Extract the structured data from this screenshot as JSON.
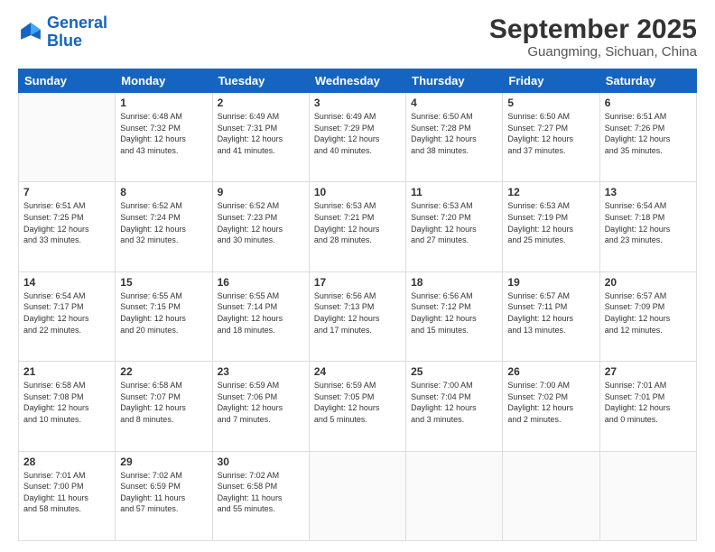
{
  "logo": {
    "line1": "General",
    "line2": "Blue"
  },
  "header": {
    "month": "September 2025",
    "location": "Guangming, Sichuan, China"
  },
  "weekdays": [
    "Sunday",
    "Monday",
    "Tuesday",
    "Wednesday",
    "Thursday",
    "Friday",
    "Saturday"
  ],
  "weeks": [
    [
      {
        "day": "",
        "info": ""
      },
      {
        "day": "1",
        "info": "Sunrise: 6:48 AM\nSunset: 7:32 PM\nDaylight: 12 hours\nand 43 minutes."
      },
      {
        "day": "2",
        "info": "Sunrise: 6:49 AM\nSunset: 7:31 PM\nDaylight: 12 hours\nand 41 minutes."
      },
      {
        "day": "3",
        "info": "Sunrise: 6:49 AM\nSunset: 7:29 PM\nDaylight: 12 hours\nand 40 minutes."
      },
      {
        "day": "4",
        "info": "Sunrise: 6:50 AM\nSunset: 7:28 PM\nDaylight: 12 hours\nand 38 minutes."
      },
      {
        "day": "5",
        "info": "Sunrise: 6:50 AM\nSunset: 7:27 PM\nDaylight: 12 hours\nand 37 minutes."
      },
      {
        "day": "6",
        "info": "Sunrise: 6:51 AM\nSunset: 7:26 PM\nDaylight: 12 hours\nand 35 minutes."
      }
    ],
    [
      {
        "day": "7",
        "info": "Sunrise: 6:51 AM\nSunset: 7:25 PM\nDaylight: 12 hours\nand 33 minutes."
      },
      {
        "day": "8",
        "info": "Sunrise: 6:52 AM\nSunset: 7:24 PM\nDaylight: 12 hours\nand 32 minutes."
      },
      {
        "day": "9",
        "info": "Sunrise: 6:52 AM\nSunset: 7:23 PM\nDaylight: 12 hours\nand 30 minutes."
      },
      {
        "day": "10",
        "info": "Sunrise: 6:53 AM\nSunset: 7:21 PM\nDaylight: 12 hours\nand 28 minutes."
      },
      {
        "day": "11",
        "info": "Sunrise: 6:53 AM\nSunset: 7:20 PM\nDaylight: 12 hours\nand 27 minutes."
      },
      {
        "day": "12",
        "info": "Sunrise: 6:53 AM\nSunset: 7:19 PM\nDaylight: 12 hours\nand 25 minutes."
      },
      {
        "day": "13",
        "info": "Sunrise: 6:54 AM\nSunset: 7:18 PM\nDaylight: 12 hours\nand 23 minutes."
      }
    ],
    [
      {
        "day": "14",
        "info": "Sunrise: 6:54 AM\nSunset: 7:17 PM\nDaylight: 12 hours\nand 22 minutes."
      },
      {
        "day": "15",
        "info": "Sunrise: 6:55 AM\nSunset: 7:15 PM\nDaylight: 12 hours\nand 20 minutes."
      },
      {
        "day": "16",
        "info": "Sunrise: 6:55 AM\nSunset: 7:14 PM\nDaylight: 12 hours\nand 18 minutes."
      },
      {
        "day": "17",
        "info": "Sunrise: 6:56 AM\nSunset: 7:13 PM\nDaylight: 12 hours\nand 17 minutes."
      },
      {
        "day": "18",
        "info": "Sunrise: 6:56 AM\nSunset: 7:12 PM\nDaylight: 12 hours\nand 15 minutes."
      },
      {
        "day": "19",
        "info": "Sunrise: 6:57 AM\nSunset: 7:11 PM\nDaylight: 12 hours\nand 13 minutes."
      },
      {
        "day": "20",
        "info": "Sunrise: 6:57 AM\nSunset: 7:09 PM\nDaylight: 12 hours\nand 12 minutes."
      }
    ],
    [
      {
        "day": "21",
        "info": "Sunrise: 6:58 AM\nSunset: 7:08 PM\nDaylight: 12 hours\nand 10 minutes."
      },
      {
        "day": "22",
        "info": "Sunrise: 6:58 AM\nSunset: 7:07 PM\nDaylight: 12 hours\nand 8 minutes."
      },
      {
        "day": "23",
        "info": "Sunrise: 6:59 AM\nSunset: 7:06 PM\nDaylight: 12 hours\nand 7 minutes."
      },
      {
        "day": "24",
        "info": "Sunrise: 6:59 AM\nSunset: 7:05 PM\nDaylight: 12 hours\nand 5 minutes."
      },
      {
        "day": "25",
        "info": "Sunrise: 7:00 AM\nSunset: 7:04 PM\nDaylight: 12 hours\nand 3 minutes."
      },
      {
        "day": "26",
        "info": "Sunrise: 7:00 AM\nSunset: 7:02 PM\nDaylight: 12 hours\nand 2 minutes."
      },
      {
        "day": "27",
        "info": "Sunrise: 7:01 AM\nSunset: 7:01 PM\nDaylight: 12 hours\nand 0 minutes."
      }
    ],
    [
      {
        "day": "28",
        "info": "Sunrise: 7:01 AM\nSunset: 7:00 PM\nDaylight: 11 hours\nand 58 minutes."
      },
      {
        "day": "29",
        "info": "Sunrise: 7:02 AM\nSunset: 6:59 PM\nDaylight: 11 hours\nand 57 minutes."
      },
      {
        "day": "30",
        "info": "Sunrise: 7:02 AM\nSunset: 6:58 PM\nDaylight: 11 hours\nand 55 minutes."
      },
      {
        "day": "",
        "info": ""
      },
      {
        "day": "",
        "info": ""
      },
      {
        "day": "",
        "info": ""
      },
      {
        "day": "",
        "info": ""
      }
    ]
  ]
}
